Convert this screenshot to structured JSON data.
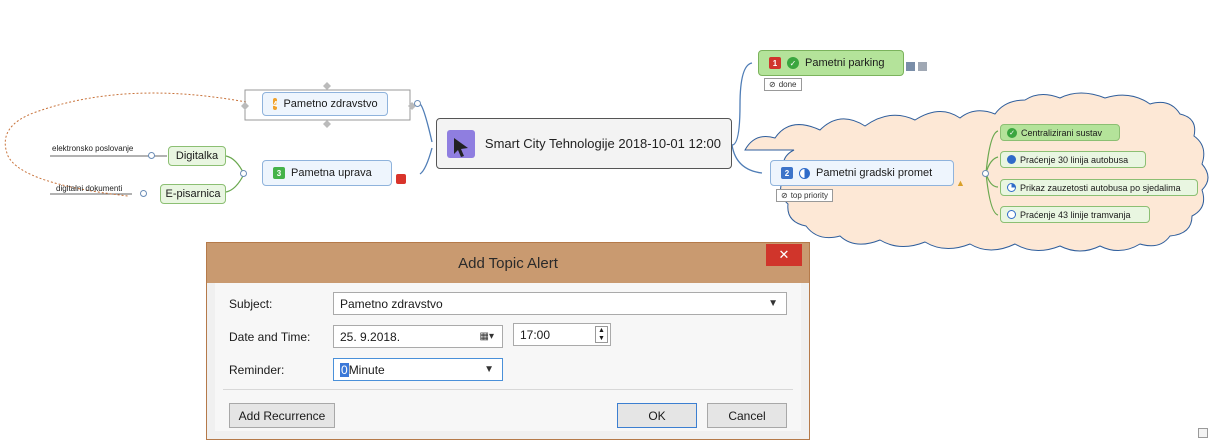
{
  "mindmap": {
    "central": {
      "title": "Smart City Tehnologije 2018-10-01 12:00"
    },
    "topics": {
      "zdravstvo": {
        "label": "Pametno zdravstvo",
        "priority": "4"
      },
      "uprava": {
        "label": "Pametna uprava",
        "priority": "3"
      },
      "parking": {
        "label": "Pametni parking",
        "priority": "1",
        "tag": "done"
      },
      "promet": {
        "label": "Pametni gradski promet",
        "priority": "2",
        "tag": "top priority"
      },
      "digitalka": {
        "label": "Digitalka",
        "note": "elektronsko poslovanje"
      },
      "episarnica": {
        "label": "E-pisarnica",
        "note": "digitalni dokumenti"
      },
      "promet_sub": [
        {
          "label": "Centralizirani sustav",
          "status": "done"
        },
        {
          "label": "Praćenje 30 linija autobusa",
          "status": "75%"
        },
        {
          "label": "Prikaz zauzetosti autobusa po sjedalima",
          "status": "25%"
        },
        {
          "label": "Praćenje 43 linije tramvanja",
          "status": "0%"
        }
      ]
    },
    "colors": {
      "cloud": "#fde8d6",
      "parking_fill": "#b4e39a",
      "topic_fill": "#eef5fd"
    }
  },
  "dialog": {
    "title": "Add Topic Alert",
    "close_label": "✕",
    "subject_label": "Subject:",
    "subject_value": "Pametno zdravstvo",
    "datetime_label": "Date and Time:",
    "date_value": "25.  9.2018.",
    "time_value": "17:00",
    "reminder_label": "Reminder:",
    "reminder_number": "0",
    "reminder_unit": "Minute",
    "add_recurrence_label": "Add Recurrence",
    "ok_label": "OK",
    "cancel_label": "Cancel",
    "accent_close": "#d0352b",
    "titlebar_color": "#c99a70"
  }
}
